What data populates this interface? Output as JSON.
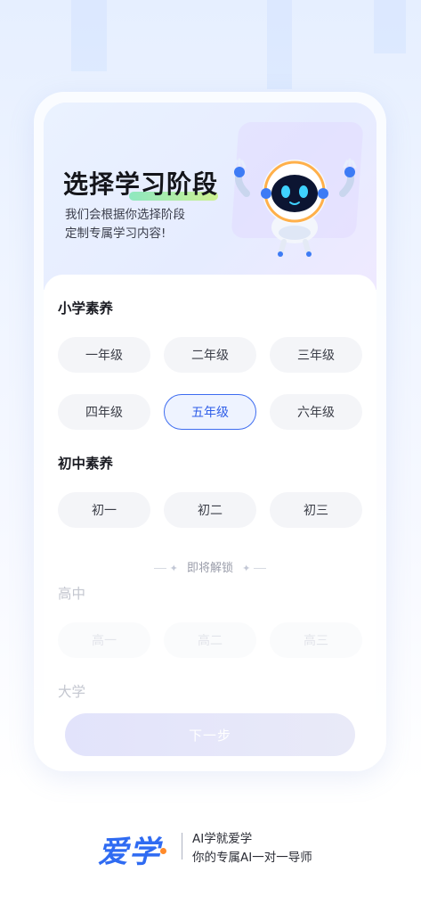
{
  "hero": {
    "title": "选择学习阶段",
    "subtitle_line1": "我们会根据你选择阶段",
    "subtitle_line2": "定制专属学习内容!"
  },
  "sections": {
    "primary": {
      "title": "小学素养",
      "grades": [
        "一年级",
        "二年级",
        "三年级",
        "四年级",
        "五年级",
        "六年级"
      ],
      "selected": "五年级"
    },
    "junior": {
      "title": "初中素养",
      "grades": [
        "初一",
        "初二",
        "初三"
      ]
    },
    "divider_label": "即将解锁",
    "senior": {
      "title": "高中",
      "grades": [
        "高一",
        "高二",
        "高三"
      ]
    },
    "college": {
      "title": "大学"
    }
  },
  "next_button": "下一步",
  "brand": {
    "logo": "爱学",
    "tagline1": "AI学就爱学",
    "tagline2": "你的专属AI一对一导师"
  },
  "colors": {
    "accent": "#2f5ee8",
    "brand_blue": "#2f6bf2",
    "brand_orange": "#ff8a2a"
  }
}
